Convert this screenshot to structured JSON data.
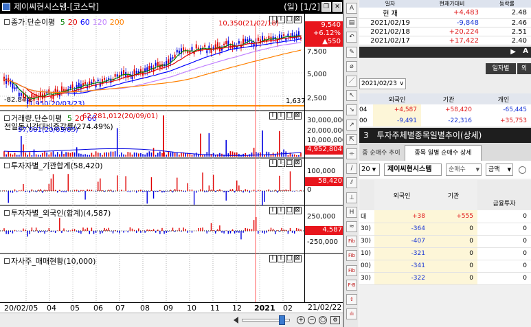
{
  "chart_window": {
    "title": "제이씨현시스템-[코스닥]",
    "period": "(일) [1/2]",
    "price_pane": {
      "label": "종가.단순이평",
      "ma_periods": [
        "5",
        "20",
        "60",
        "120",
        "200"
      ],
      "ma_colors": [
        "#008000",
        "#e00000",
        "#0000ff",
        "#c080ff",
        "#ff8000"
      ],
      "high_annotation": "10,350(21/02/18)",
      "low_annotation": "1,950(20/03/23)",
      "current_price": "9,540",
      "change_pct": "+6.12%",
      "change_abs": "▲550",
      "left_pct": "-82.84%",
      "y_ticks": [
        "7,500",
        "5,000",
        "2,500"
      ],
      "baseline_value": "1,637"
    },
    "volume_pane": {
      "label": "거래량.단순이평",
      "ma_periods": [
        "5",
        "20",
        "60"
      ],
      "sublabel": "전일동시간대비증감률(274.49%)",
      "peak_annotation": "62,281,012(20/09/01)",
      "low_annotation": "97,001(20/03/05)",
      "y_ticks": [
        "30,000,000",
        "20,000,000",
        "10,000,000"
      ],
      "current_value": "4,952,804"
    },
    "institution_pane": {
      "label": "투자자별_기관합계(58,420)",
      "y_ticks": [
        "100,000",
        "0"
      ],
      "current_value": "58,420"
    },
    "foreign_pane": {
      "label": "투자자별_외국인(합계)(4,587)",
      "y_ticks": [
        "250,000",
        "-250,000"
      ],
      "current_value": "4,587"
    },
    "treasury_pane": {
      "label": "자사주_매매현황(10,000)"
    },
    "x_axis": {
      "labels": [
        "20/02/05",
        "04",
        "05",
        "06",
        "07",
        "08",
        "09",
        "10",
        "11",
        "12",
        "2021",
        "02"
      ],
      "end_label": "21/02/22"
    },
    "pane_buttons": [
      "I",
      "I",
      "□",
      "⊠"
    ]
  },
  "toolbar_icons": [
    "A",
    "▤",
    "↶",
    "✎",
    "⌀",
    "／",
    "↖",
    "↘",
    "↗",
    "⇱",
    "⌯",
    "∕",
    "⫽",
    "⊥",
    "H",
    "≈",
    "Fib",
    "Fib",
    "Fib",
    "F-B",
    "↕",
    "ılı"
  ],
  "right_panel": {
    "top_table": {
      "headers": [
        "일자",
        "현재가대비",
        "등락률"
      ],
      "rows": [
        {
          "date": "현 재",
          "value": "+4,483",
          "ratio": "2.48",
          "tone": "red"
        },
        {
          "date": "2021/02/19",
          "value": "-9,848",
          "ratio": "2.46",
          "tone": "blue"
        },
        {
          "date": "2021/02/18",
          "value": "+20,224",
          "ratio": "2.51",
          "tone": "red"
        },
        {
          "date": "2021/02/17",
          "value": "+17,422",
          "ratio": "2.40",
          "tone": "red"
        }
      ]
    },
    "top_bar_letter": "A",
    "mid_button": "일자별",
    "mid_button2": "외",
    "date_select": "2021/02/23",
    "mid_headers": [
      "외국인",
      "기관",
      "개인"
    ],
    "mid_rows": [
      {
        "date": "04",
        "foreign": "+4,587",
        "inst": "+58,420",
        "indiv": "-65,445"
      },
      {
        "date": "00",
        "foreign": "-9,491",
        "inst": "-22,316",
        "indiv": "+35,753"
      }
    ],
    "panel3": {
      "number": "3",
      "title": "투자주체별종목일별추이(상세)",
      "tabs": [
        "종 순매수 추이",
        "종목 일별 순매수 상세"
      ],
      "select_period": "20",
      "stock_name": "제이씨현시스템",
      "net_buy_select": "순매수",
      "amount_select": "금액",
      "headers": [
        "외국인",
        "기관",
        "금융투자"
      ],
      "rows": [
        {
          "date": "대",
          "foreign": "+38",
          "inst": "+555",
          "fin": "0"
        },
        {
          "date": "30)",
          "foreign": "-364",
          "inst": "0",
          "fin": "0"
        },
        {
          "date": "30)",
          "foreign": "-407",
          "inst": "0",
          "fin": "0"
        },
        {
          "date": "10)",
          "foreign": "-321",
          "inst": "0",
          "fin": "0"
        },
        {
          "date": "00)",
          "foreign": "-341",
          "inst": "0",
          "fin": "0"
        },
        {
          "date": "30)",
          "foreign": "-322",
          "inst": "0",
          "fin": "0"
        }
      ]
    }
  }
}
